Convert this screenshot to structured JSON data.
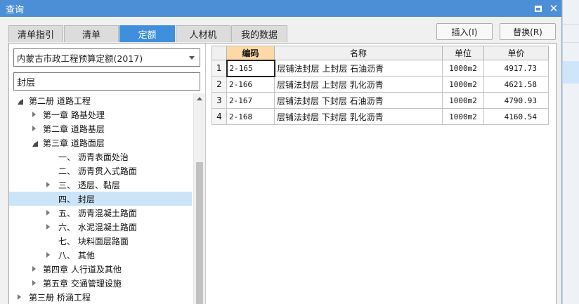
{
  "window": {
    "title": "查询"
  },
  "tabs": [
    {
      "label": "清单指引",
      "active": false
    },
    {
      "label": "清单",
      "active": false
    },
    {
      "label": "定额",
      "active": true
    },
    {
      "label": "人材机",
      "active": false
    },
    {
      "label": "我的数据",
      "active": false
    }
  ],
  "actions": {
    "insert_label": "插入(I)",
    "replace_label": "替换(R)"
  },
  "library": {
    "selected": "内蒙古市政工程预算定额(2017)"
  },
  "search": {
    "value": "封层"
  },
  "tree": [
    {
      "label": "第二册 道路工程",
      "level": 0,
      "state": "expanded"
    },
    {
      "label": "第一章 路基处理",
      "level": 1,
      "state": "collapsed"
    },
    {
      "label": "第二章 道路基层",
      "level": 1,
      "state": "collapsed"
    },
    {
      "label": "第三章 道路面层",
      "level": 1,
      "state": "expanded"
    },
    {
      "label": "一、 沥青表面处治",
      "level": 2,
      "state": "leaf"
    },
    {
      "label": "二、 沥青贯入式路面",
      "level": 2,
      "state": "leaf"
    },
    {
      "label": "三、 透层、黏层",
      "level": 2,
      "state": "collapsed"
    },
    {
      "label": "四、 封层",
      "level": 2,
      "state": "leaf",
      "selected": true
    },
    {
      "label": "五、 沥青混凝土路面",
      "level": 2,
      "state": "collapsed"
    },
    {
      "label": "六、 水泥混凝土路面",
      "level": 2,
      "state": "collapsed"
    },
    {
      "label": "七、 块料面层路面",
      "level": 2,
      "state": "leaf"
    },
    {
      "label": "八、 其他",
      "level": 2,
      "state": "collapsed"
    },
    {
      "label": "第四章 人行道及其他",
      "level": 1,
      "state": "collapsed"
    },
    {
      "label": "第五章 交通管理设施",
      "level": 1,
      "state": "collapsed"
    },
    {
      "label": "第三册 桥涵工程",
      "level": 0,
      "state": "collapsed"
    }
  ],
  "table": {
    "headers": {
      "code": "编码",
      "name": "名称",
      "unit": "单位",
      "price": "单价"
    },
    "rows": [
      {
        "num": "1",
        "code": "2-165",
        "name": "层铺法封层 上封层 石油沥青",
        "unit": "1000m2",
        "price": "4917.73"
      },
      {
        "num": "2",
        "code": "2-166",
        "name": "层铺法封层 上封层 乳化沥青",
        "unit": "1000m2",
        "price": "4621.58"
      },
      {
        "num": "3",
        "code": "2-167",
        "name": "层铺法封层 下封层 石油沥青",
        "unit": "1000m2",
        "price": "4790.93"
      },
      {
        "num": "4",
        "code": "2-168",
        "name": "层铺法封层 下封层 乳化沥青",
        "unit": "1000m2",
        "price": "4160.54"
      }
    ]
  },
  "colors": {
    "titlebar": "#4d8fd6",
    "active_tab": "#3f8fdc",
    "code_header": "#fcd9a6",
    "selection": "#cce4f7"
  }
}
